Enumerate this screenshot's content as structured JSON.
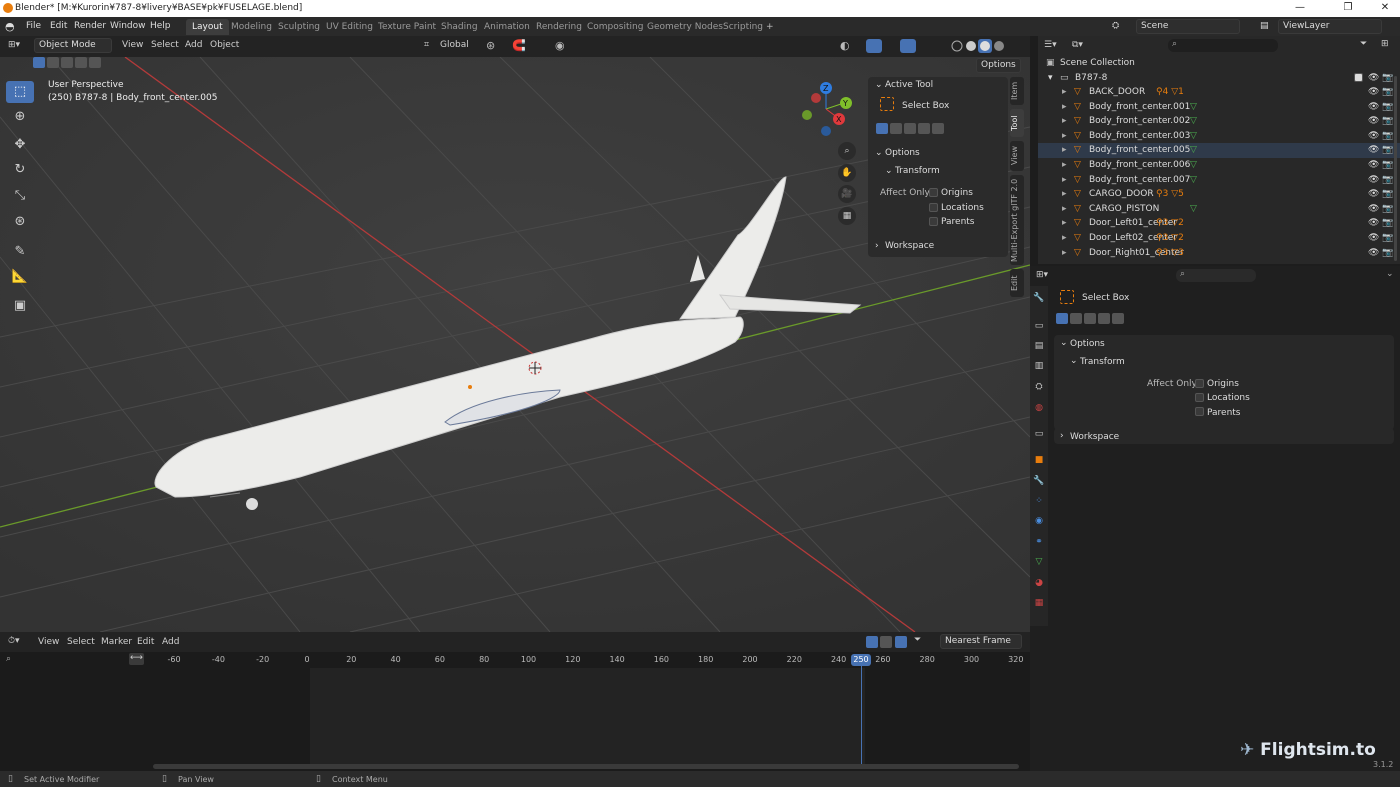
{
  "window": {
    "title": "Blender* [M:¥Kurorin¥787-8¥livery¥BASE¥pk¥FUSELAGE.blend]",
    "min": "—",
    "max": "❐",
    "close": "✕"
  },
  "menu": {
    "items": [
      "File",
      "Edit",
      "Render",
      "Window",
      "Help"
    ],
    "workspaces": [
      "Layout",
      "Modeling",
      "Sculpting",
      "UV Editing",
      "Texture Paint",
      "Shading",
      "Animation",
      "Rendering",
      "Compositing",
      "Geometry Nodes",
      "Scripting"
    ],
    "active_workspace": "Layout",
    "add_ws": "+",
    "scene": "Scene",
    "view_layer": "ViewLayer"
  },
  "viewport_header": {
    "mode": "Object Mode",
    "menus": [
      "View",
      "Select",
      "Add",
      "Object"
    ],
    "orientation": "Global",
    "options": "Options"
  },
  "viewport": {
    "perspective": "User Perspective",
    "info": "(250) B787-8 | Body_front_center.005",
    "gizmo": {
      "x": "X",
      "y": "Y",
      "z": "Z"
    }
  },
  "tools": [
    "select-box",
    "cursor",
    "move",
    "rotate",
    "scale",
    "transform",
    "annotate",
    "measure",
    "add-cube"
  ],
  "npanel": {
    "active_tool": "Active Tool",
    "select_box": "Select Box",
    "options": "Options",
    "transform": "Transform",
    "affect_only": "Affect Only",
    "origins": "Origins",
    "locations": "Locations",
    "parents": "Parents",
    "workspace": "Workspace"
  },
  "ntabs": [
    "Item",
    "Tool",
    "View",
    "Multi-Export glTF 2.0",
    "Edit"
  ],
  "outliner": {
    "scene_collection": "Scene Collection",
    "root": "B787-8",
    "items": [
      {
        "name": "BACK_DOOR",
        "badge": "4",
        "badge2": "1"
      },
      {
        "name": "Body_front_center.001"
      },
      {
        "name": "Body_front_center.002"
      },
      {
        "name": "Body_front_center.003"
      },
      {
        "name": "Body_front_center.005"
      },
      {
        "name": "Body_front_center.006"
      },
      {
        "name": "Body_front_center.007"
      },
      {
        "name": "CARGO_DOOR",
        "badge": "3",
        "badge2": "5"
      },
      {
        "name": "CARGO_PISTON"
      },
      {
        "name": "Door_Left01_center",
        "badge": "3",
        "badge2": "2"
      },
      {
        "name": "Door_Left02_center",
        "badge": "3",
        "badge2": "2"
      },
      {
        "name": "Door_Right01_center",
        "badge": "3",
        "badge2": "3"
      }
    ]
  },
  "props": {
    "select_box": "Select Box",
    "options": "Options",
    "transform": "Transform",
    "affect_only": "Affect Only",
    "origins": "Origins",
    "locations": "Locations",
    "parents": "Parents",
    "workspace": "Workspace"
  },
  "timeline": {
    "menus": [
      "View",
      "Select",
      "Marker",
      "Edit",
      "Add"
    ],
    "snap": "Nearest Frame",
    "ticks": [
      "-60",
      "-40",
      "-20",
      "0",
      "20",
      "40",
      "60",
      "80",
      "100",
      "120",
      "140",
      "160",
      "180",
      "200",
      "220",
      "240",
      "260",
      "280",
      "300",
      "320"
    ],
    "current": "250"
  },
  "statusbar": {
    "left": "Set Active Modifier",
    "mid": "Pan View",
    "right": "Context Menu",
    "version": "3.1.2"
  },
  "watermark": "Flightsim.to",
  "colors": {
    "accent": "#4772b3",
    "orange": "#e87d0d",
    "green_axis": "#6a9a2a",
    "red_axis": "#b33a3a",
    "frame": "#4772b3"
  }
}
